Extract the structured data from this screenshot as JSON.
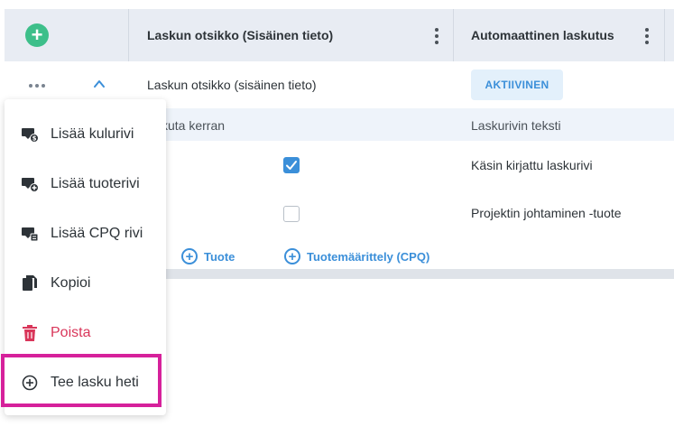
{
  "header": {
    "add_button": "+",
    "col_title": "Laskun otsikko (Sisäinen tieto)",
    "col_auto_billing": "Automaattinen laskutus"
  },
  "row": {
    "title": "Laskun otsikko (sisäinen tieto)",
    "status_badge": "AKTIIVINEN"
  },
  "subheader": {
    "partial_label": "kuta kerran",
    "line_text_label": "Laskurivin teksti"
  },
  "items": [
    {
      "checked": true,
      "text": "Käsin kirjattu laskurivi"
    },
    {
      "checked": false,
      "text": "Projektin johtaminen -tuote"
    }
  ],
  "add_links": {
    "product": "Tuote",
    "cpq": "Tuotemäärittely (CPQ)"
  },
  "menu": {
    "items": [
      {
        "label": "Lisää kulurivi",
        "icon": "expense-row-icon"
      },
      {
        "label": "Lisää tuoterivi",
        "icon": "product-row-icon"
      },
      {
        "label": "Lisää CPQ rivi",
        "icon": "cpq-row-icon"
      },
      {
        "label": "Kopioi",
        "icon": "copy-icon"
      },
      {
        "label": "Poista",
        "icon": "trash-icon"
      },
      {
        "label": "Tee lasku heti",
        "icon": "plus-circle-icon"
      }
    ]
  },
  "colors": {
    "accent": "#3b8fd9",
    "add_green": "#3dbf8a",
    "danger": "#d9365a",
    "highlight": "#d6219b"
  }
}
